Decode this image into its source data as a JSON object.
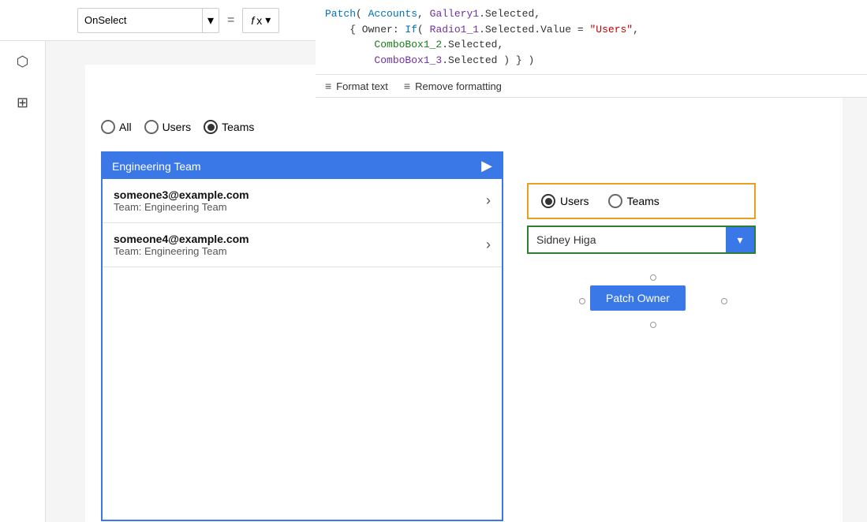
{
  "toolbar": {
    "dropdown_label": "OnSelect",
    "equals": "=",
    "fx_label": "fx"
  },
  "formula": {
    "line1": "Patch( Accounts, Gallery1.Selected,",
    "line2_a": "{ Owner: If( ",
    "line2_b": "Radio1_1",
    "line2_c": ".Selected.Value = ",
    "line2_d": "\"Users\"",
    "line2_e": ",",
    "line3_a": "ComboBox1_2",
    "line3_b": ".Selected,",
    "line4_a": "ComboBox1_3",
    "line4_b": ".Selected ) } )",
    "format_text_label": "Format text",
    "remove_formatting_label": "Remove formatting"
  },
  "sidebar": {
    "icons": [
      "☰",
      "⬡",
      "⊞"
    ]
  },
  "radio_group": {
    "all_label": "All",
    "users_label": "Users",
    "teams_label": "Teams",
    "selected": "Teams"
  },
  "gallery": {
    "header": "Engineering Team",
    "items": [
      {
        "email": "someone3@example.com",
        "team": "Team: Engineering Team"
      },
      {
        "email": "someone4@example.com",
        "team": "Team: Engineering Team"
      }
    ]
  },
  "right_panel": {
    "users_label": "Users",
    "teams_label": "Teams",
    "selected": "Users",
    "combo_value": "Sidney Higa",
    "combo_placeholder": "Sidney Higa"
  },
  "patch_button": {
    "label": "Patch Owner"
  }
}
